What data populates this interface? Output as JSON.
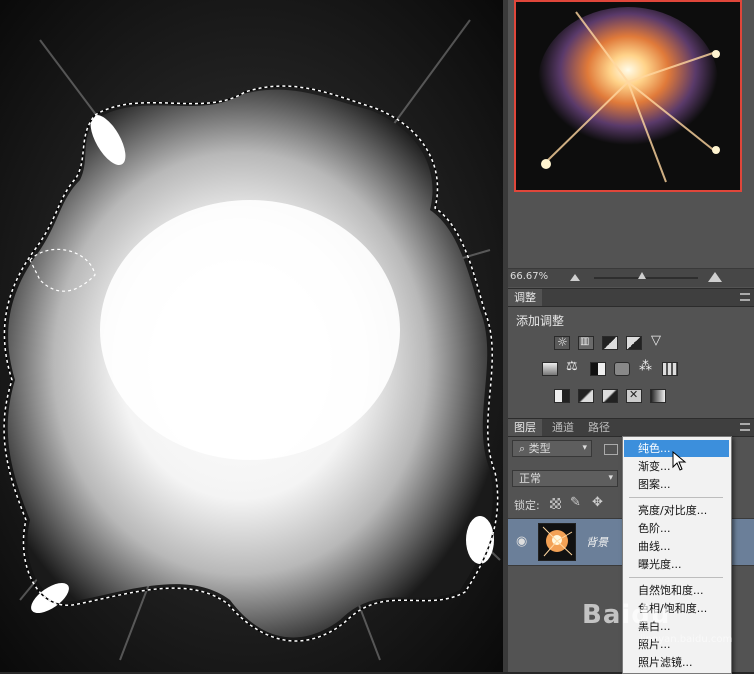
{
  "navigator": {
    "zoom": "66.67%",
    "thumbnail_alt": "explosion preview"
  },
  "adjustments": {
    "tab_label": "调整",
    "title": "添加调整",
    "rows": [
      [
        "brightness-contrast-icon",
        "levels-icon",
        "curves-icon",
        "exposure-icon",
        "vibrance-icon"
      ],
      [
        "hue-saturation-icon",
        "color-balance-icon",
        "black-white-icon",
        "photo-filter-icon",
        "channel-mixer-icon",
        "color-lookup-icon"
      ],
      [
        "invert-icon",
        "posterize-icon",
        "threshold-icon",
        "selective-color-icon",
        "gradient-map-icon"
      ]
    ]
  },
  "layers": {
    "tabs": [
      "图层",
      "通道",
      "路径"
    ],
    "filter_kind": "类型",
    "blend_mode": "正常",
    "lock_label": "锁定:",
    "layer_name": "背景"
  },
  "context_menu": {
    "items": [
      {
        "label": "纯色...",
        "selected": true
      },
      {
        "label": "渐变..."
      },
      {
        "label": "图案..."
      },
      {
        "sep": true
      },
      {
        "label": "亮度/对比度..."
      },
      {
        "label": "色阶..."
      },
      {
        "label": "曲线..."
      },
      {
        "label": "曝光度..."
      },
      {
        "sep": true
      },
      {
        "label": "自然饱和度..."
      },
      {
        "label": "色相/饱和度..."
      },
      {
        "label": "黑白..."
      },
      {
        "label": "照片..."
      },
      {
        "label": "照片滤镜..."
      }
    ]
  },
  "watermark": {
    "brand": "Baidu",
    "sub": "jingyan.baidu.com"
  },
  "colors": {
    "panel_bg": "#535353",
    "selection_blue": "#3c8fdc",
    "navigator_frame": "#e0463a",
    "layer_selected": "#6b7f99"
  }
}
